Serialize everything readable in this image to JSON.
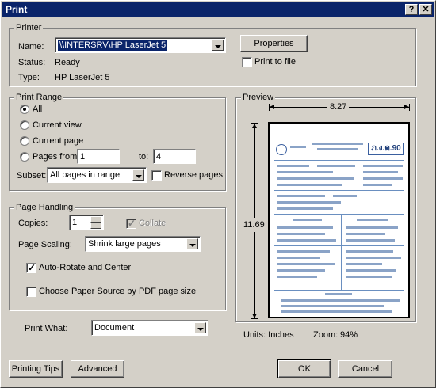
{
  "window": {
    "title": "Print",
    "help_button": "?",
    "close_button": "✕"
  },
  "printer": {
    "group_label": "Printer",
    "name_label": "Name:",
    "name_value": "\\\\INTERSRV\\HP LaserJet 5",
    "status_label": "Status:",
    "status_value": "Ready",
    "type_label": "Type:",
    "type_value": "HP LaserJet 5",
    "properties_button": "Properties",
    "print_to_file_label": "Print to file"
  },
  "print_range": {
    "group_label": "Print Range",
    "all_label": "All",
    "current_view_label": "Current view",
    "current_page_label": "Current page",
    "pages_from_label": "Pages from:",
    "pages_from_value": "1",
    "to_label": "to:",
    "to_value": "4",
    "subset_label": "Subset:",
    "subset_value": "All pages in range",
    "reverse_pages_label": "Reverse pages",
    "selected": "all"
  },
  "page_handling": {
    "group_label": "Page Handling",
    "copies_label": "Copies:",
    "copies_value": "1",
    "collate_label": "Collate",
    "page_scaling_label": "Page Scaling:",
    "page_scaling_value": "Shrink large pages",
    "auto_rotate_label": "Auto-Rotate and Center",
    "auto_rotate_checked": true,
    "choose_paper_label": "Choose Paper Source by PDF page size",
    "choose_paper_checked": false
  },
  "print_what": {
    "label": "Print What:",
    "value": "Document"
  },
  "preview": {
    "group_label": "Preview",
    "width_value": "8.27",
    "height_value": "11.69",
    "units_label": "Units: Inches",
    "zoom_label": "Zoom:",
    "zoom_value": "94%",
    "doc_form_code": "ภ.ง.ด.90"
  },
  "buttons": {
    "printing_tips": "Printing Tips",
    "advanced": "Advanced",
    "ok": "OK",
    "cancel": "Cancel"
  },
  "colors": {
    "titlebar": "#0a246a",
    "dialog_bg": "#d4d0c8",
    "selection": "#0a246a"
  }
}
